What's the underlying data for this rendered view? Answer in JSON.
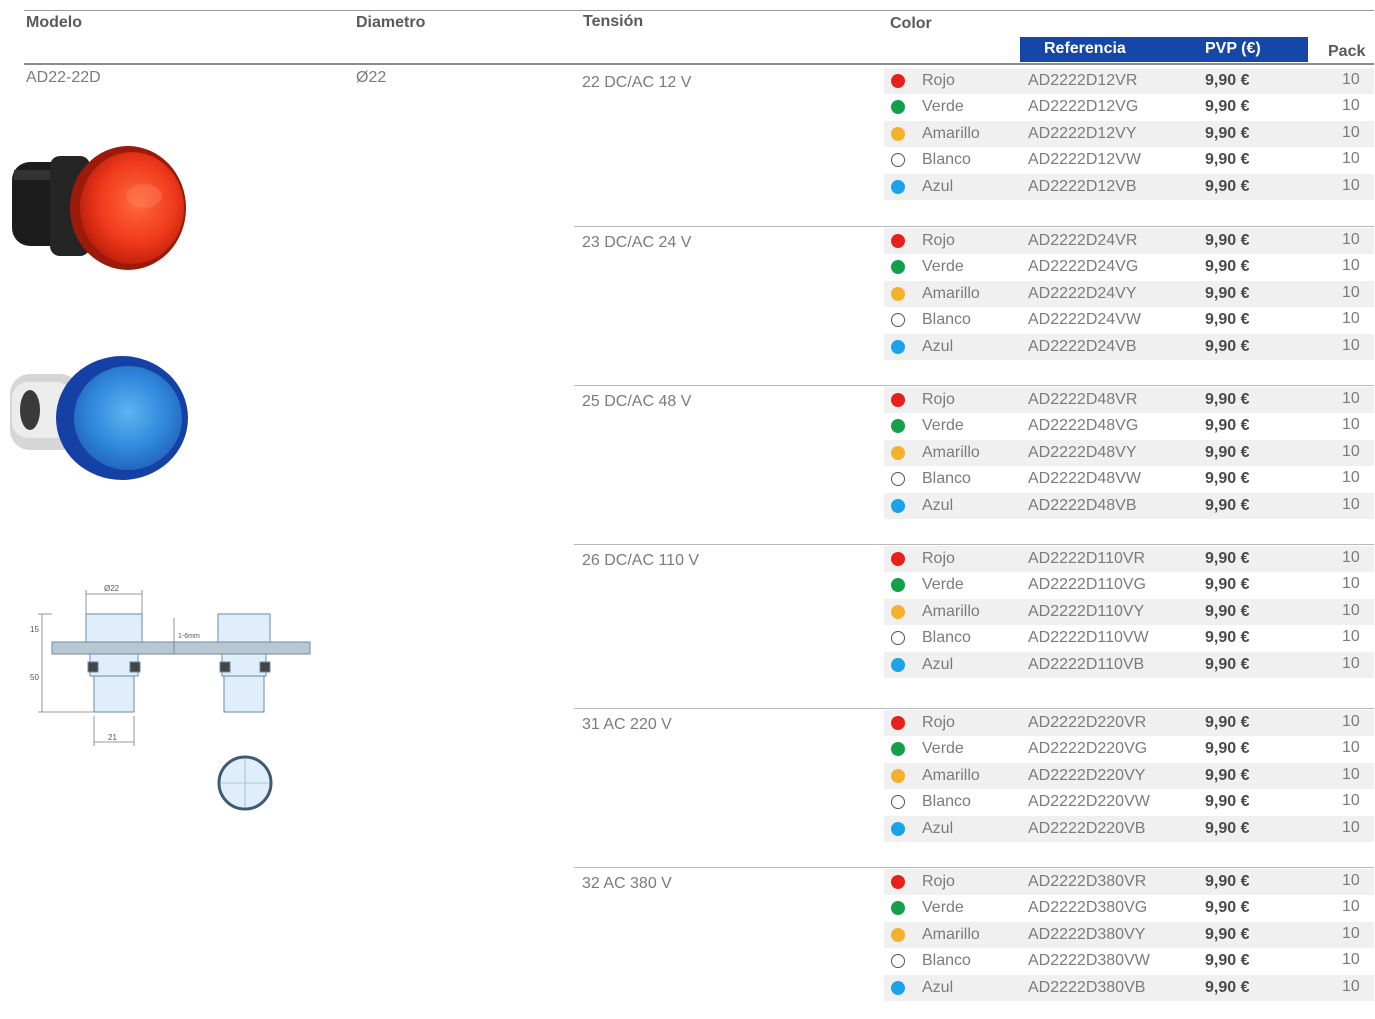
{
  "headers": {
    "modelo": "Modelo",
    "diametro": "Diametro",
    "tension": "Tensión",
    "color": "Color",
    "referencia": "Referencia",
    "pvp": "PVP (€)",
    "pack": "Pack"
  },
  "product": {
    "model": "AD22-22D",
    "diameter": "Ø22"
  },
  "colors": {
    "Rojo": "#e8201c",
    "Verde": "#14a04a",
    "Amarillo": "#f5b12e",
    "Blanco": "#ffffff",
    "Azul": "#1aa3e8",
    "header_bar": "#1547a8"
  },
  "groups": [
    {
      "voltage": "22 DC/AC 12 V",
      "rows": [
        {
          "color": "Rojo",
          "ref": "AD2222D12VR",
          "price": "9,90 €",
          "pack": "10"
        },
        {
          "color": "Verde",
          "ref": "AD2222D12VG",
          "price": "9,90 €",
          "pack": "10"
        },
        {
          "color": "Amarillo",
          "ref": "AD2222D12VY",
          "price": "9,90 €",
          "pack": "10"
        },
        {
          "color": "Blanco",
          "ref": "AD2222D12VW",
          "price": "9,90 €",
          "pack": "10"
        },
        {
          "color": "Azul",
          "ref": "AD2222D12VB",
          "price": "9,90 €",
          "pack": "10"
        }
      ]
    },
    {
      "voltage": "23 DC/AC 24 V",
      "rows": [
        {
          "color": "Rojo",
          "ref": "AD2222D24VR",
          "price": "9,90 €",
          "pack": "10"
        },
        {
          "color": "Verde",
          "ref": "AD2222D24VG",
          "price": "9,90 €",
          "pack": "10"
        },
        {
          "color": "Amarillo",
          "ref": "AD2222D24VY",
          "price": "9,90 €",
          "pack": "10"
        },
        {
          "color": "Blanco",
          "ref": "AD2222D24VW",
          "price": "9,90 €",
          "pack": "10"
        },
        {
          "color": "Azul",
          "ref": "AD2222D24VB",
          "price": "9,90 €",
          "pack": "10"
        }
      ]
    },
    {
      "voltage": "25 DC/AC 48 V",
      "rows": [
        {
          "color": "Rojo",
          "ref": "AD2222D48VR",
          "price": "9,90 €",
          "pack": "10"
        },
        {
          "color": "Verde",
          "ref": "AD2222D48VG",
          "price": "9,90 €",
          "pack": "10"
        },
        {
          "color": "Amarillo",
          "ref": "AD2222D48VY",
          "price": "9,90 €",
          "pack": "10"
        },
        {
          "color": "Blanco",
          "ref": "AD2222D48VW",
          "price": "9,90 €",
          "pack": "10"
        },
        {
          "color": "Azul",
          "ref": "AD2222D48VB",
          "price": "9,90 €",
          "pack": "10"
        }
      ]
    },
    {
      "voltage": "26 DC/AC 110 V",
      "rows": [
        {
          "color": "Rojo",
          "ref": "AD2222D110VR",
          "price": "9,90 €",
          "pack": "10"
        },
        {
          "color": "Verde",
          "ref": "AD2222D110VG",
          "price": "9,90 €",
          "pack": "10"
        },
        {
          "color": "Amarillo",
          "ref": "AD2222D110VY",
          "price": "9,90 €",
          "pack": "10"
        },
        {
          "color": "Blanco",
          "ref": "AD2222D110VW",
          "price": "9,90 €",
          "pack": "10"
        },
        {
          "color": "Azul",
          "ref": "AD2222D110VB",
          "price": "9,90 €",
          "pack": "10"
        }
      ]
    },
    {
      "voltage": "31 AC 220 V",
      "rows": [
        {
          "color": "Rojo",
          "ref": "AD2222D220VR",
          "price": "9,90 €",
          "pack": "10"
        },
        {
          "color": "Verde",
          "ref": "AD2222D220VG",
          "price": "9,90 €",
          "pack": "10"
        },
        {
          "color": "Amarillo",
          "ref": "AD2222D220VY",
          "price": "9,90 €",
          "pack": "10"
        },
        {
          "color": "Blanco",
          "ref": "AD2222D220VW",
          "price": "9,90 €",
          "pack": "10"
        },
        {
          "color": "Azul",
          "ref": "AD2222D220VB",
          "price": "9,90 €",
          "pack": "10"
        }
      ]
    },
    {
      "voltage": "32 AC 380 V",
      "rows": [
        {
          "color": "Rojo",
          "ref": "AD2222D380VR",
          "price": "9,90 €",
          "pack": "10"
        },
        {
          "color": "Verde",
          "ref": "AD2222D380VG",
          "price": "9,90 €",
          "pack": "10"
        },
        {
          "color": "Amarillo",
          "ref": "AD2222D380VY",
          "price": "9,90 €",
          "pack": "10"
        },
        {
          "color": "Blanco",
          "ref": "AD2222D380VW",
          "price": "9,90 €",
          "pack": "10"
        },
        {
          "color": "Azul",
          "ref": "AD2222D380VB",
          "price": "9,90 €",
          "pack": "10"
        }
      ]
    }
  ],
  "drawing": {
    "dim_diameter": "Ø22",
    "dim_height": "15",
    "dim_depth": "50",
    "dim_base": "21",
    "dim_panel": "1-6mm"
  },
  "icons": [
    "red-pilot-light-photo",
    "blue-pilot-light-photo",
    "dimension-drawing",
    "cutout-circle-drawing"
  ]
}
